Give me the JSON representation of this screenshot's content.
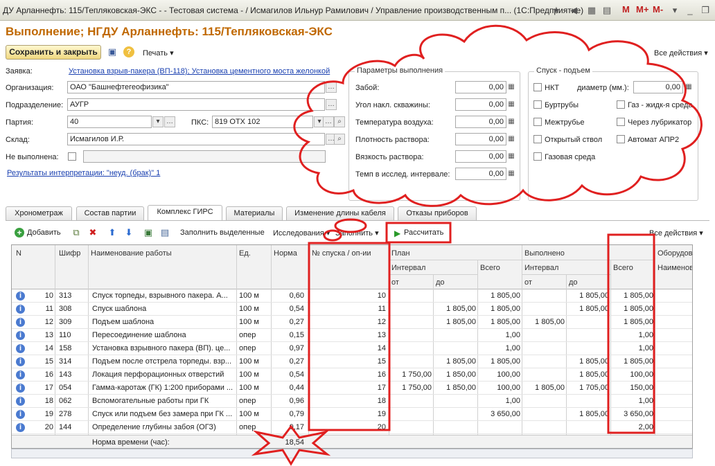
{
  "window": {
    "title": "ДУ Арланнефть: 115/Тепляковская-ЭКС - - Тестовая система - / Исмагилов Ильнур Рамилович / Управление производственным п... (1С:Предприятие)",
    "memory_buttons": [
      "M",
      "M+",
      "M-"
    ]
  },
  "form": {
    "title": "Выполнение; НГДУ Арланнефть: 115/Тепляковская-ЭКС",
    "save_close": "Сохранить и закрыть",
    "print": "Печать",
    "all_actions": "Все действия"
  },
  "fields": {
    "zayavka_label": "Заявка:",
    "zayavka_value": "Установка взрыв-пакера (ВП-118); Установка цементного моста желонкой",
    "org_label": "Организация:",
    "org_value": "ОАО \"Башнефтегеофизика\"",
    "podr_label": "Подразделение:",
    "podr_value": "АУГР",
    "partiya_label": "Партия:",
    "partiya_value": "40",
    "pks_label": "ПКС:",
    "pks_value": "819 ОТХ 102",
    "sklad_label": "Склад:",
    "sklad_value": "Исмагилов И.Р.",
    "ne_vyp_label": "Не выполнена:",
    "results_link": "Результаты интерпретации: \"неуд. (брак)\" 1"
  },
  "params": {
    "title": "Параметры выполнения",
    "items": [
      {
        "label": "Забой:",
        "value": "0,00"
      },
      {
        "label": "Угол накл. скважины:",
        "value": "0,00"
      },
      {
        "label": "Температура воздуха:",
        "value": "0,00"
      },
      {
        "label": "Плотность раствора:",
        "value": "0,00"
      },
      {
        "label": "Вязкость раствора:",
        "value": "0,00"
      },
      {
        "label": "Темп в исслед. интервале:",
        "value": "0,00"
      }
    ]
  },
  "spusk": {
    "title": "Спуск - подъем",
    "nkt": "НКТ",
    "diam_label": "диаметр (мм.):",
    "diam_value": "0,00",
    "burtruby": "Буртрубы",
    "gas_liquid": "Газ - жидк-я среда",
    "mezhtrube": "Межтрубье",
    "lubrikator": "Через лубрикатор",
    "otkr_stvol": "Открытый ствол",
    "avtomat": "Автомат АПР2",
    "gas_sreda": "Газовая среда"
  },
  "tabs": [
    "Хронометраж",
    "Состав партии",
    "Комплекс ГИРС",
    "Материалы",
    "Изменение длины кабеля",
    "Отказы приборов"
  ],
  "toolbar": {
    "add": "Добавить",
    "fill_selected": "Заполнить выделенные",
    "research": "Исследования",
    "fill": "Заполнить",
    "calculate": "Рассчитать",
    "all_actions": "Все действия"
  },
  "table": {
    "headers": {
      "n": "N",
      "shifr": "Шифр",
      "name": "Наименование работы",
      "ed": "Ед.",
      "norma": "Норма",
      "nspuska": "№ спуска / оп-ии",
      "plan": "План",
      "interval": "Интервал",
      "vsego": "Всего",
      "ot": "от",
      "do": "до",
      "vypolneno": "Выполнено",
      "oborud": "Оборудова",
      "naimenov": "Наименов"
    },
    "rows": [
      {
        "n": "10",
        "shifr": "313",
        "name": "Спуск торпеды, взрывного пакера. А...",
        "ed": "100 м",
        "norma": "0,60",
        "nsp": "10",
        "p_ot": "",
        "p_do": "",
        "p_vs": "1 805,00",
        "v_ot": "",
        "v_do": "1 805,00",
        "v_vs": "1 805,00"
      },
      {
        "n": "11",
        "shifr": "308",
        "name": "Спуск шаблона",
        "ed": "100 м",
        "norma": "0,54",
        "nsp": "11",
        "p_ot": "",
        "p_do": "1 805,00",
        "p_vs": "1 805,00",
        "v_ot": "",
        "v_do": "1 805,00",
        "v_vs": "1 805,00"
      },
      {
        "n": "12",
        "shifr": "309",
        "name": "Подъем шаблона",
        "ed": "100 м",
        "norma": "0,27",
        "nsp": "12",
        "p_ot": "",
        "p_do": "1 805,00",
        "p_vs": "1 805,00",
        "v_ot": "1 805,00",
        "v_do": "",
        "v_vs": "1 805,00"
      },
      {
        "n": "13",
        "shifr": "110",
        "name": "Пересоединение шаблона",
        "ed": "опер",
        "norma": "0,15",
        "nsp": "13",
        "p_ot": "",
        "p_do": "",
        "p_vs": "1,00",
        "v_ot": "",
        "v_do": "",
        "v_vs": "1,00"
      },
      {
        "n": "14",
        "shifr": "158",
        "name": "Установка взрывного пакера (ВП). це...",
        "ed": "опер",
        "norma": "0,97",
        "nsp": "14",
        "p_ot": "",
        "p_do": "",
        "p_vs": "1,00",
        "v_ot": "",
        "v_do": "",
        "v_vs": "1,00"
      },
      {
        "n": "15",
        "shifr": "314",
        "name": "Подъем после отстрела торпеды. взр...",
        "ed": "100 м",
        "norma": "0,27",
        "nsp": "15",
        "p_ot": "",
        "p_do": "1 805,00",
        "p_vs": "1 805,00",
        "v_ot": "",
        "v_do": "1 805,00",
        "v_vs": "1 805,00"
      },
      {
        "n": "16",
        "shifr": "143",
        "name": "Локация перфорационных отверстий",
        "ed": "100 м",
        "norma": "0,54",
        "nsp": "16",
        "p_ot": "1 750,00",
        "p_do": "1 850,00",
        "p_vs": "100,00",
        "v_ot": "",
        "v_do": "1 805,00",
        "v_vs": "100,00"
      },
      {
        "n": "17",
        "shifr": "054",
        "name": "Гамма-каротаж (ГК) 1:200 приборами ...",
        "ed": "100 м",
        "norma": "0,44",
        "nsp": "17",
        "p_ot": "1 750,00",
        "p_do": "1 850,00",
        "p_vs": "100,00",
        "v_ot": "1 805,00",
        "v_do": "1 705,00",
        "v_vs": "150,00"
      },
      {
        "n": "18",
        "shifr": "062",
        "name": "Вспомогательные работы при ГК",
        "ed": "опер",
        "norma": "0,96",
        "nsp": "18",
        "p_ot": "",
        "p_do": "",
        "p_vs": "1,00",
        "v_ot": "",
        "v_do": "",
        "v_vs": "1,00"
      },
      {
        "n": "19",
        "shifr": "278",
        "name": "Спуск или подъем без замера при ГК ...",
        "ed": "100 м",
        "norma": "0,79",
        "nsp": "19",
        "p_ot": "",
        "p_do": "",
        "p_vs": "3 650,00",
        "v_ot": "",
        "v_do": "1 805,00",
        "v_vs": "3 650,00"
      },
      {
        "n": "20",
        "shifr": "144",
        "name": "Определение глубины забоя (ОГЗ)",
        "ed": "опер",
        "norma": "0,17",
        "nsp": "20",
        "p_ot": "",
        "p_do": "",
        "p_vs": "",
        "v_ot": "",
        "v_do": "",
        "v_vs": "2,00"
      }
    ],
    "footer_label": "Норма времени (час):",
    "footer_total": "18,54"
  }
}
